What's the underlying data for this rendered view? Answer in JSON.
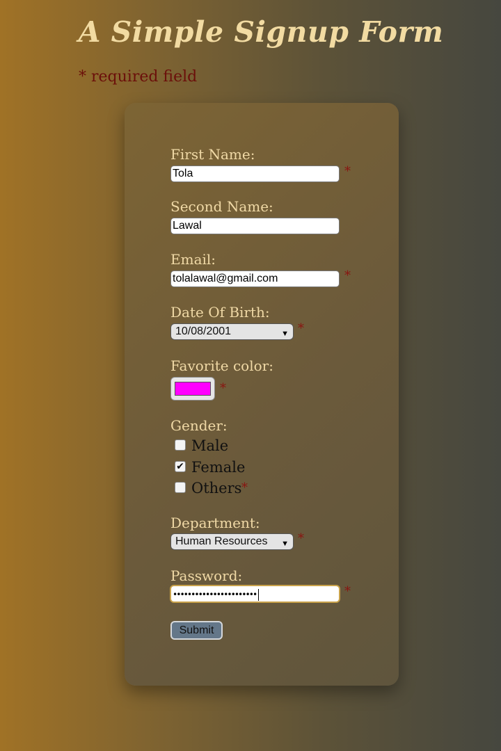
{
  "page": {
    "title": "A Simple Signup Form",
    "required_note": "* required field"
  },
  "form": {
    "required_mark": "*",
    "first_name": {
      "label": "First Name:",
      "value": "Tola",
      "required": true
    },
    "second_name": {
      "label": "Second Name:",
      "value": "Lawal",
      "required": false
    },
    "email": {
      "label": "Email:",
      "value": "tolalawal@gmail.com",
      "required": true
    },
    "dob": {
      "label": "Date Of Birth:",
      "value": "10/08/2001",
      "required": true
    },
    "favorite_color": {
      "label": "Favorite color:",
      "value": "#ff00ff",
      "required": true
    },
    "gender": {
      "label": "Gender:",
      "options": [
        {
          "label": "Male",
          "checked": false
        },
        {
          "label": "Female",
          "checked": true
        },
        {
          "label": "Others",
          "checked": false
        }
      ],
      "required": true
    },
    "department": {
      "label": "Department:",
      "value": "Human Resources",
      "required": true
    },
    "password": {
      "label": "Password:",
      "masked_value": "•••••••••••••••••••••••",
      "required": true,
      "focused": true
    },
    "submit_label": "Submit"
  },
  "colors": {
    "title": "#f2dba2",
    "label": "#f0d9a6",
    "required": "#8a1410",
    "submit_bg": "#647789"
  },
  "icons": {
    "select_caret": "▼",
    "checkmark": "✔"
  }
}
